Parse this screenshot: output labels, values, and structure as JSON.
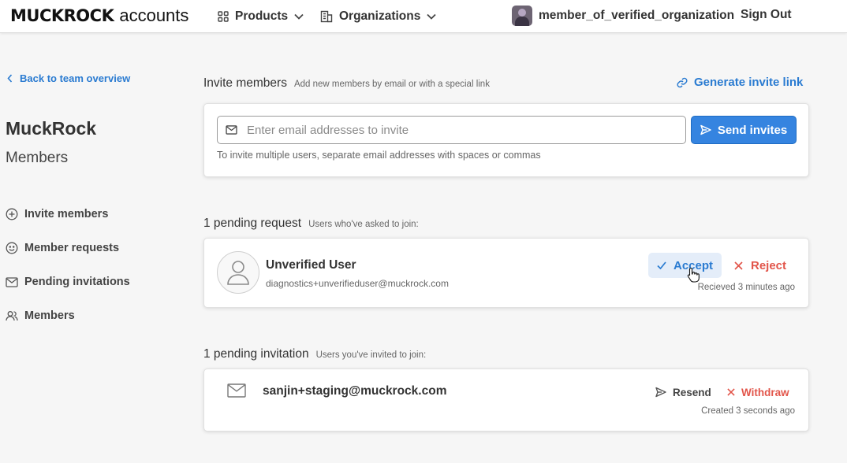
{
  "header": {
    "logo_brand": "MUCKROCK",
    "logo_suffix": "accounts",
    "nav": [
      {
        "label": "Products",
        "icon": "grid-icon"
      },
      {
        "label": "Organizations",
        "icon": "building-icon"
      }
    ],
    "user": {
      "name": "member_of_verified_organization"
    },
    "sign_out": "Sign Out"
  },
  "sidebar": {
    "back_link": "Back to team overview",
    "org_name": "MuckRock",
    "page_title": "Members",
    "items": [
      {
        "label": "Invite members",
        "icon": "plus-circle-icon"
      },
      {
        "label": "Member requests",
        "icon": "smiley-icon"
      },
      {
        "label": "Pending invitations",
        "icon": "mail-icon"
      },
      {
        "label": "Members",
        "icon": "people-icon"
      }
    ]
  },
  "invite": {
    "title": "Invite members",
    "description": "Add new members by email or with a special link",
    "generate_link": "Generate invite link",
    "input_value": "",
    "input_placeholder": "Enter email addresses to invite",
    "send_button": "Send invites",
    "hint": "To invite multiple users, separate email addresses with spaces or commas"
  },
  "requests": {
    "title": "1 pending request",
    "description": "Users who've asked to join:",
    "items": [
      {
        "name": "Unverified User",
        "email": "diagnostics+unverifieduser@muckrock.com",
        "accept": "Accept",
        "reject": "Reject",
        "meta": "Recieved 3 minutes ago"
      }
    ]
  },
  "invitations": {
    "title": "1 pending invitation",
    "description": "Users you've invited to join:",
    "items": [
      {
        "email": "sanjin+staging@muckrock.com",
        "resend": "Resend",
        "withdraw": "Withdraw",
        "meta": "Created 3 seconds ago"
      }
    ]
  },
  "colors": {
    "link_blue": "#2a7bd1",
    "primary_button": "#3584e0",
    "danger": "#e2554a",
    "background": "#f6f6f6"
  }
}
